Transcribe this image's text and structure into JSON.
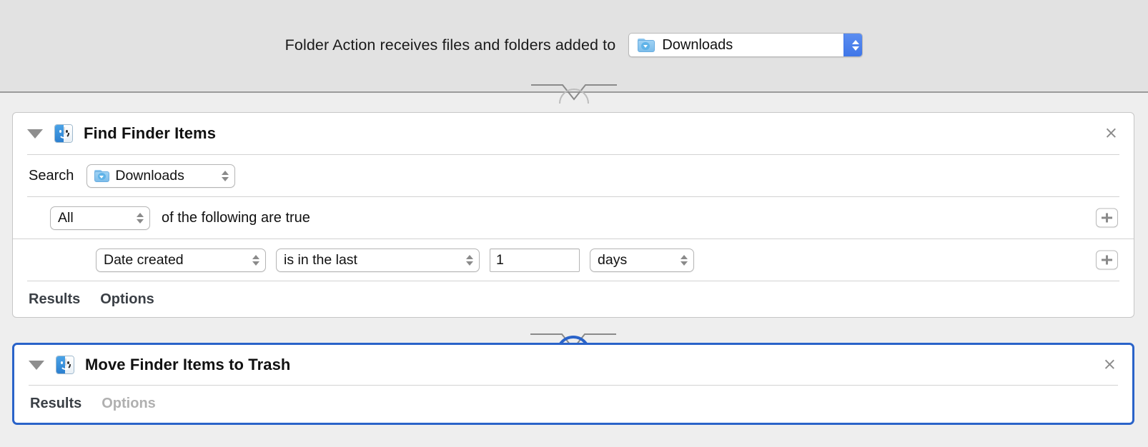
{
  "header": {
    "label": "Folder Action receives files and folders added to",
    "folder_popup": {
      "value": "Downloads",
      "icon": "downloads-folder-icon",
      "stepper_icon": "up-down-chevron-icon",
      "accent": "#3f76e8"
    }
  },
  "actions": [
    {
      "id": "find-finder-items",
      "title": "Find Finder Items",
      "icon": "finder-icon",
      "disclosure_icon": "disclosure-triangle-down-icon",
      "close_icon": "close-icon",
      "close_label": "×",
      "selected": false,
      "search": {
        "label": "Search",
        "value": "Downloads",
        "icon": "downloads-folder-icon"
      },
      "match": {
        "value": "All",
        "label": "of the following are true",
        "add_label": "+"
      },
      "criteria": [
        {
          "attribute": "Date created",
          "operator": "is in the last",
          "amount": "1",
          "unit": "days",
          "add_label": "+"
        }
      ],
      "tabs": [
        {
          "label": "Results",
          "disabled": false
        },
        {
          "label": "Options",
          "disabled": false
        }
      ]
    },
    {
      "id": "move-finder-items-to-trash",
      "title": "Move Finder Items to Trash",
      "icon": "finder-icon",
      "disclosure_icon": "disclosure-triangle-down-icon",
      "close_icon": "close-icon",
      "close_label": "×",
      "selected": true,
      "selection_color": "#2a63c9",
      "tabs": [
        {
          "label": "Results",
          "disabled": false
        },
        {
          "label": "Options",
          "disabled": true
        }
      ]
    }
  ]
}
